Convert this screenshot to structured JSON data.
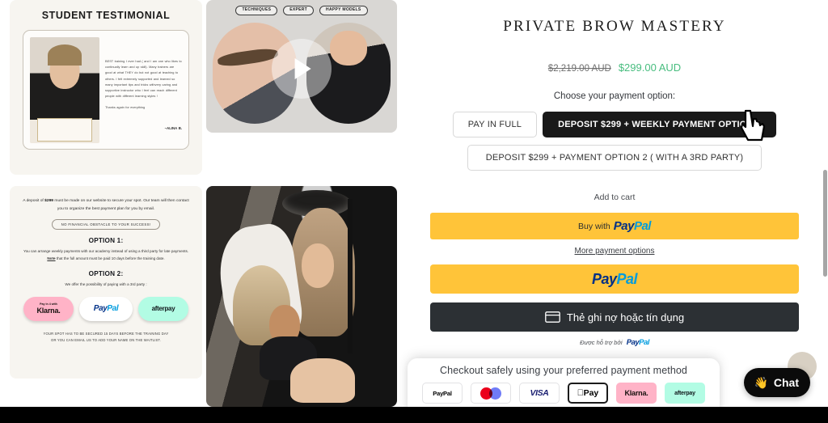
{
  "testimonial": {
    "title": "STUDENT TESTIMONIAL",
    "quote": "BEST training I ever had ( and I am one who likes to continually learn and up skill). Many trainers are good at what THEY do but not good at teaching to others. I felt extremely supported and learned so many important tips and tricks withvery caring and supportive instructor who I feel can reach different people with different learning styles !",
    "thanks": "Thanks again for everything",
    "author": "~ALINA B."
  },
  "deposit": {
    "intro_a": "A deposit of ",
    "intro_amount": "$299",
    "intro_b": " must be made on our website to secure your spot. Our team will then contact you to organize the best  payment plan for you by email.",
    "pill": "NO FINANCIAL OBSTACLE TO YOUR SUCCESS!",
    "option1_title": "OPTION 1:",
    "option1_body_a": "You can arrange weekly payments with our academy instead of using a third party for late payments. ",
    "option1_note": "Note",
    "option1_body_b": " that the full amount must be paid 10 days before the training date.",
    "option2_title": "OPTION 2:",
    "option2_body": "We offer the possibility of paying with a 3rd party :",
    "logos": {
      "klarna_small": "Pay in 4 with",
      "klarna": "Klarna.",
      "paypal_pay": "Pay",
      "paypal_pal": "Pal",
      "afterpay": "afterpay"
    },
    "footer_line1": "YOUR SPOT HAS TO BE SECURED 15 DAYS BEFORE THE TRAINING DAY",
    "footer_line2": "OR YOU CAN EMAIL US TO ADD YOUR NAME ON THE WAITLIST."
  },
  "video": {
    "tags": [
      "TECHNIQUES",
      "EXPERT",
      "HAPPY MODELS"
    ],
    "play_icon": "play-icon"
  },
  "product": {
    "title": "PRIVATE BROW MASTERY",
    "price_old": "$2,219.00 AUD",
    "price_new": "$299.00 AUD",
    "price_new_color": "#48bd7f",
    "choose_label": "Choose your payment option:",
    "options": [
      {
        "label": "PAY IN FULL",
        "selected": false
      },
      {
        "label": "DEPOSIT $299 + WEEKLY PAYMENT OPTION 1",
        "selected": true
      },
      {
        "label": "DEPOSIT $299 + PAYMENT OPTION 2 ( WITH A 3RD PARTY)",
        "selected": false
      }
    ],
    "add_to_cart": "Add to cart",
    "paypal_buy_prefix": "Buy with",
    "paypal_pay": "Pay",
    "paypal_pal": "Pal",
    "more_payment_options": "More payment options",
    "card_button_label": "Thẻ ghi nợ hoặc tín dụng",
    "card_icon": "credit-card-icon",
    "powered_by": "Được hỗ trợ bởi",
    "paypal_yellow": "#ffc439",
    "card_button_bg": "#2c3034"
  },
  "checkout": {
    "title": "Checkout safely using your preferred payment method",
    "methods": [
      {
        "name": "paypal",
        "label": "PayPal"
      },
      {
        "name": "mastercard",
        "label": ""
      },
      {
        "name": "visa",
        "label": "VISA"
      },
      {
        "name": "applepay",
        "label": "Pay"
      },
      {
        "name": "klarna",
        "label": "Klarna."
      },
      {
        "name": "afterpay",
        "label": "afterpay"
      }
    ]
  },
  "chat": {
    "label": "Chat",
    "icon": "waving-hand-icon"
  }
}
